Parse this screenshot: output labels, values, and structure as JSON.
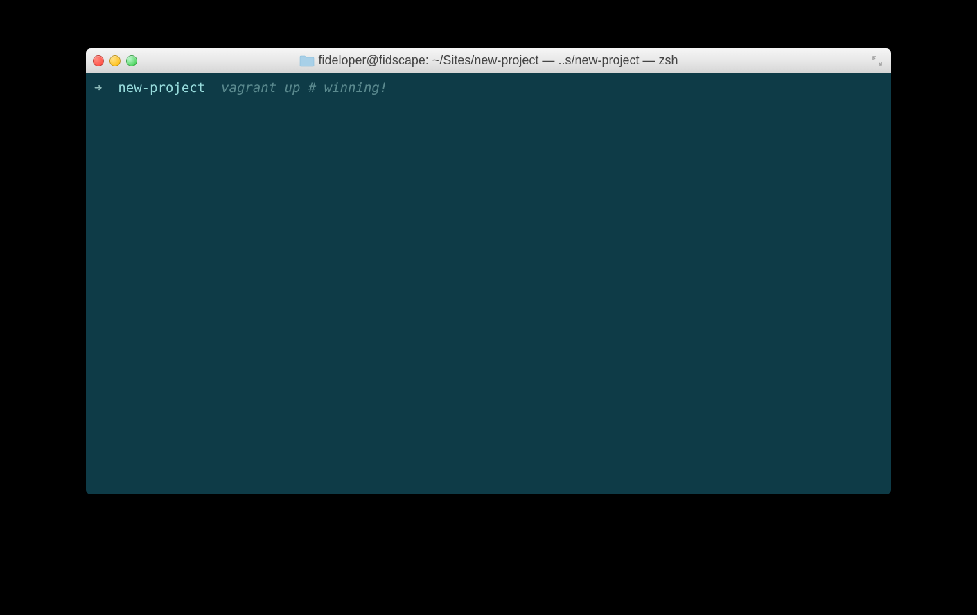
{
  "window": {
    "title": "fideloper@fidscape: ~/Sites/new-project — ..s/new-project — zsh"
  },
  "prompt": {
    "arrow": "➜",
    "dir": "new-project",
    "command": "vagrant up # winning!"
  }
}
